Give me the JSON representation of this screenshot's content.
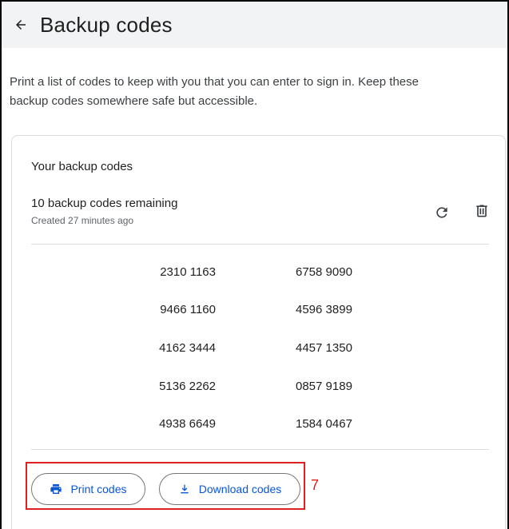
{
  "header": {
    "back_icon": "arrow-left-icon",
    "title": "Backup codes"
  },
  "description": "Print a list of codes to keep with you that you can enter to sign in. Keep these backup codes somewhere safe but accessible.",
  "card": {
    "title": "Your backup codes",
    "remaining": "10 backup codes remaining",
    "created": "Created 27 minutes ago",
    "refresh_icon": "refresh-icon",
    "delete_icon": "trash-icon",
    "codes": [
      [
        "2310 1163",
        "6758 9090"
      ],
      [
        "9466 1160",
        "4596 3899"
      ],
      [
        "4162 3444",
        "4457 1350"
      ],
      [
        "5136 2262",
        "0857 9189"
      ],
      [
        "4938 6649",
        "1584 0467"
      ]
    ],
    "print_label": "Print codes",
    "print_icon": "printer-icon",
    "download_label": "Download codes",
    "download_icon": "download-icon"
  },
  "annotation": {
    "marker": "7",
    "color": "#e02020"
  },
  "colors": {
    "accent": "#0b57d0",
    "header_bg": "#f1f3f4"
  }
}
